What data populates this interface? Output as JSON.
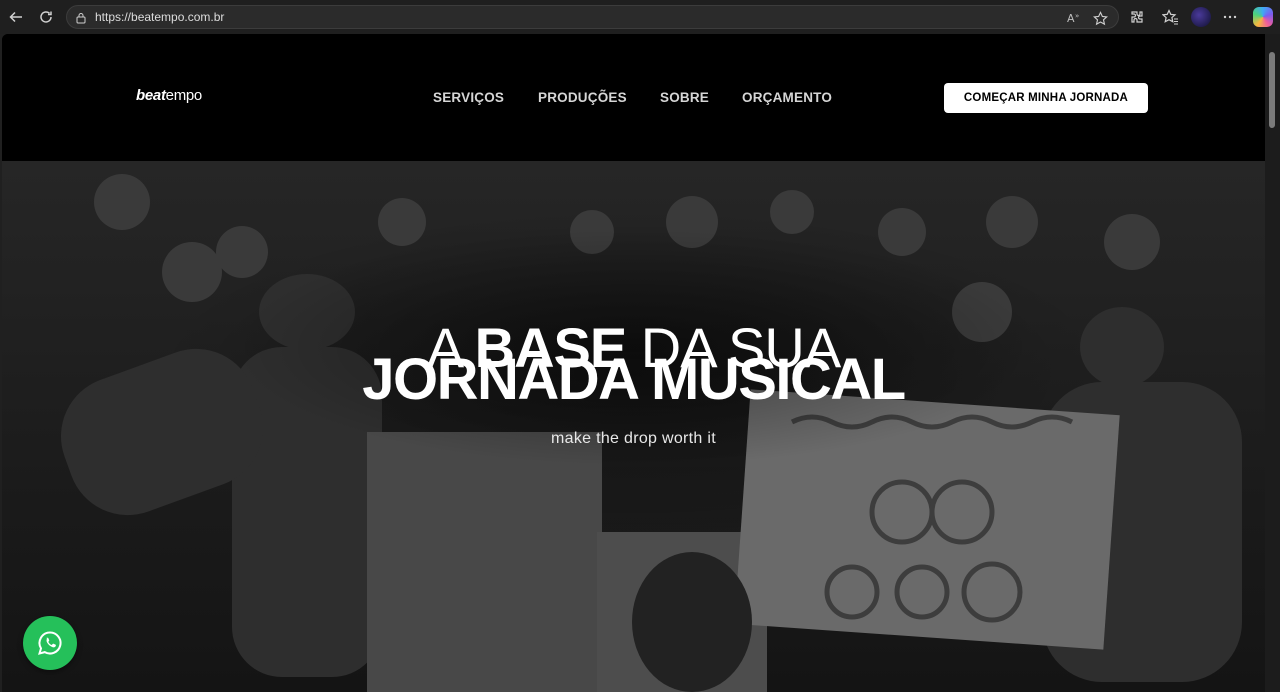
{
  "browser": {
    "url": "https://beatempo.com.br",
    "icons": [
      "back-arrow-icon",
      "reload-icon",
      "lock-icon",
      "read-aloud-icon",
      "favorite-star-icon",
      "extensions-icon",
      "favorites-icon",
      "profile-avatar",
      "more-menu-icon",
      "copilot-icon"
    ]
  },
  "site": {
    "logo": {
      "bold": "beat",
      "light": "empo"
    },
    "nav": [
      "SERVIÇOS",
      "PRODUÇÕES",
      "SOBRE",
      "ORÇAMENTO"
    ],
    "cta": "COMEÇAR MINHA JORNADA"
  },
  "hero": {
    "line1_light_a": "A ",
    "line1_bold": "BASE",
    "line1_light_b": " DA SUA",
    "line2": "JORNADA MUSICAL",
    "subtitle": "make the drop worth it"
  },
  "colors": {
    "whatsapp": "#25c05a",
    "header_bg": "#000000",
    "cta_bg": "#ffffff"
  }
}
